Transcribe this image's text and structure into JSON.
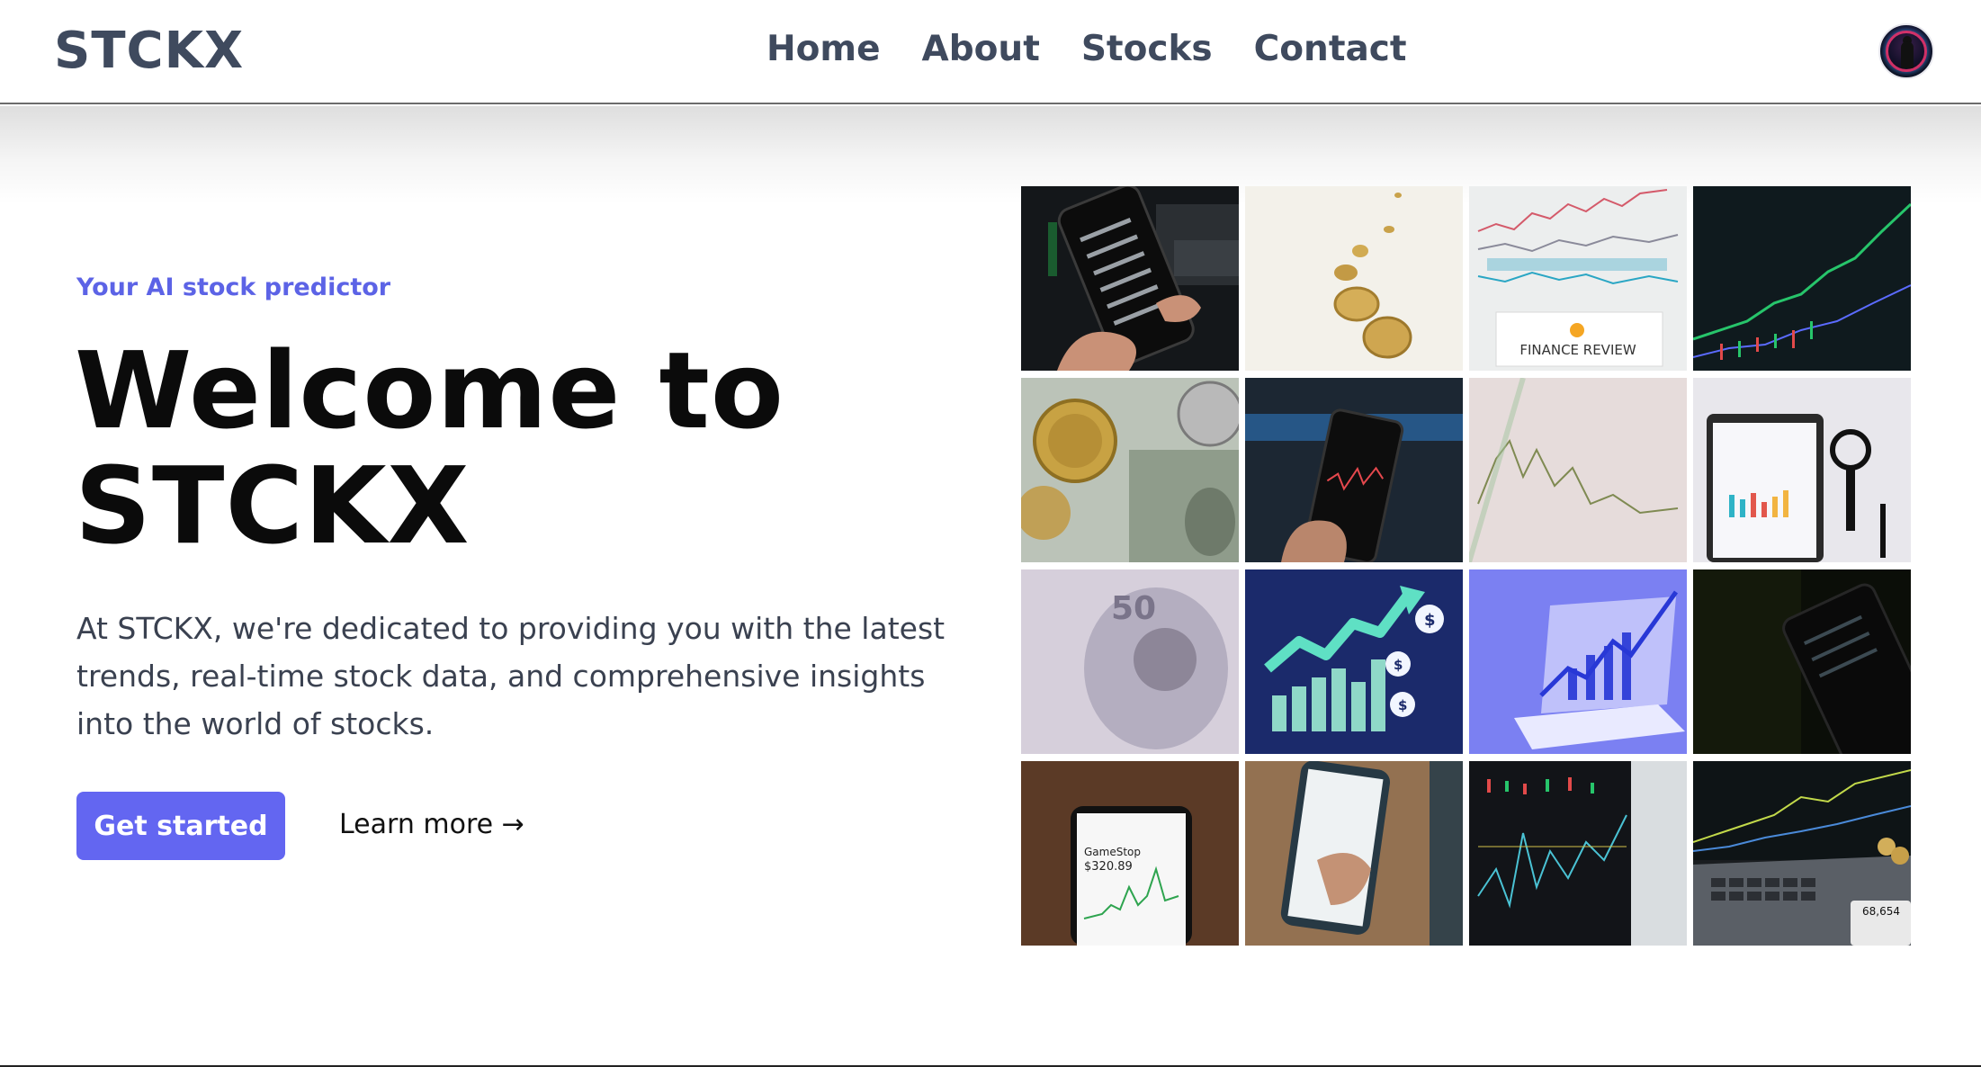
{
  "header": {
    "logo": "STCKX",
    "nav": [
      "Home",
      "About",
      "Stocks",
      "Contact"
    ]
  },
  "hero": {
    "eyebrow": "Your AI stock predictor",
    "title_line1": "Welcome to",
    "title_line2": "STCKX",
    "description": "At STCKX, we're dedicated to providing you with the latest trends, real-time stock data, and comprehensive insights into the world of stocks.",
    "primary_button": "Get started",
    "secondary_link": "Learn more →"
  },
  "grid": {
    "finance_review_label": "FINANCE REVIEW",
    "phone_stock_name": "GameStop",
    "phone_stock_price": "$320.89",
    "calculator_value": "68,654"
  },
  "colors": {
    "accent": "#6366f1",
    "logo": "#3f4a5e",
    "eyebrow": "#5c63e6"
  }
}
